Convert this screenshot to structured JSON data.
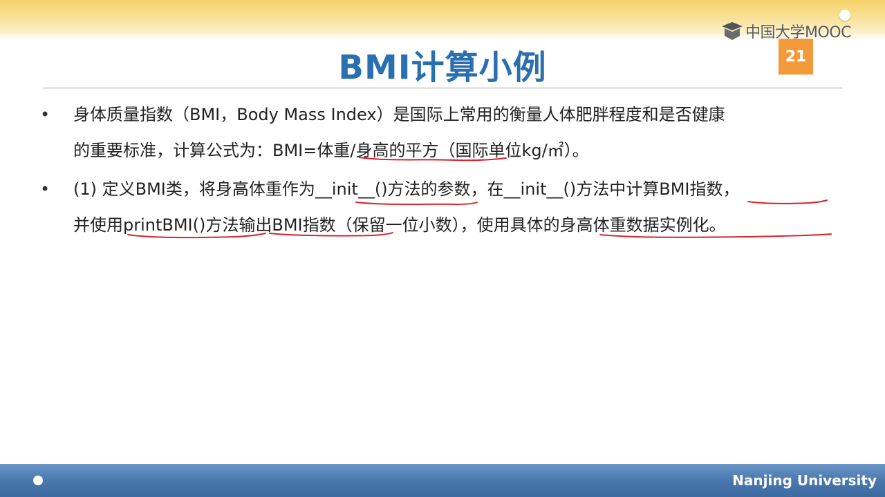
{
  "header": {
    "logo_text": "中国大学MOOC",
    "page_number": "21"
  },
  "title": "BMI计算小例",
  "bullets": [
    {
      "lines": [
        "身体质量指数（BMI，Body Mass Index）是国际上常用的衡量人体肥胖程度和是否健康",
        "的重要标准，计算公式为：BMI=体重/身高的平方（国际单位kg/㎡）。"
      ]
    },
    {
      "lines": [
        "(1) 定义BMI类，将身高体重作为__init__()方法的参数，在__init__()方法中计算BMI指数，",
        "并使用printBMI()方法输出BMI指数（保留一位小数），使用具体的身高体重数据实例化。"
      ]
    }
  ],
  "footer": {
    "university": "Nanjing University"
  },
  "colors": {
    "title": "#2a6fb0",
    "badge": "#f39a3a",
    "annotation": "#d8222b",
    "top_band": "#f6d36a",
    "bottom_band": "#4a78ad"
  }
}
